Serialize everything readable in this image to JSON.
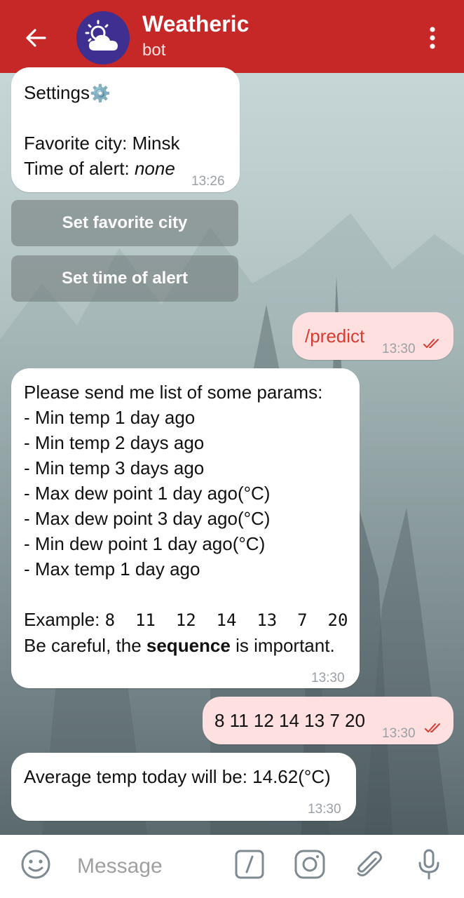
{
  "header": {
    "title": "Weatheric",
    "subtitle": "bot",
    "back_icon": "arrow-left-icon",
    "menu_icon": "more-vertical-icon",
    "avatar_icon": "sun-cloud-icon",
    "color": "#c62828"
  },
  "messages": {
    "settings": {
      "title": "Settings",
      "gear": "⚙️",
      "city": "Favorite city: Minsk",
      "alert_label": "Time of alert: ",
      "alert_value": "none",
      "time": "13:26"
    },
    "buttons": {
      "set_city": "Set favorite city",
      "set_alert": "Set time of alert"
    },
    "predict_cmd": {
      "text": "/predict",
      "time": "13:30",
      "status_icon": "double-check-icon"
    },
    "params": {
      "intro": "Please send me list of some params:",
      "items": [
        "- Min temp 1 day ago",
        "- Min temp 2 days ago",
        "- Min temp 3 days ago",
        "- Max dew point 1 day ago(°C)",
        "- Max dew point 3 day ago(°C)",
        "- Min dew point 1 day ago(°C)",
        "- Max temp 1 day ago"
      ],
      "example_label": "Example: ",
      "example_value": "8  11  12  14  13  7  20",
      "careful_pre": "Be careful, the ",
      "careful_bold": "sequence",
      "careful_post": " is important.",
      "time": "13:30"
    },
    "user_values": {
      "text": "8 11 12 14 13 7 20",
      "time": "13:30",
      "status_icon": "double-check-icon"
    },
    "result": {
      "text": "Average temp today will be: 14.62(°C)",
      "time": "13:30"
    }
  },
  "input": {
    "placeholder": "Message",
    "emoji_icon": "smile-icon",
    "command_icon": "slash-command-icon",
    "camera_icon": "instagram-camera-icon",
    "attach_icon": "paperclip-icon",
    "mic_icon": "microphone-icon"
  }
}
